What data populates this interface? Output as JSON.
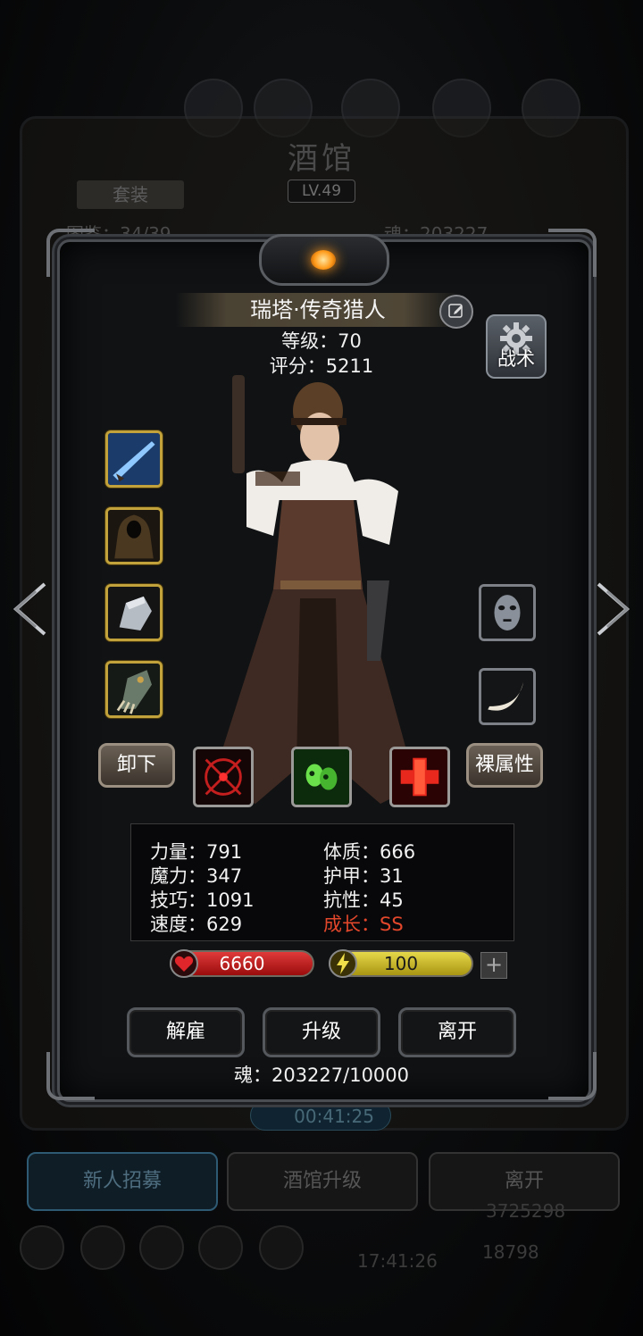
{
  "background": {
    "title": "酒馆",
    "level": "LV.49",
    "tab": "套装",
    "member_count": "图鉴：34/39",
    "soul_total": "魂：203227",
    "timer": "00:41:25",
    "clock": "17:41:26",
    "gold": "3725298",
    "gems": "18798",
    "buttons": [
      "新人招募",
      "酒馆升级",
      "离开"
    ]
  },
  "hero": {
    "name": "瑞塔·传奇猎人",
    "level_text": "等级：70",
    "score_text": "评分：5211",
    "tactics_label": "战术"
  },
  "equipment": {
    "left": [
      "rifle-weapon",
      "hooded-cloak",
      "steel-gauntlet",
      "clawed-gauntlet"
    ],
    "right": [
      "tribal-mask",
      "curved-horn"
    ]
  },
  "controls": {
    "unequip_label": "卸下",
    "base_attr_label": "裸属性"
  },
  "skills": [
    "crosshair-skill",
    "poison-skull-skill",
    "heal-cross-skill"
  ],
  "attributes": {
    "strength": "力量：791",
    "constitution": "体质：666",
    "magic": "魔力：347",
    "armor": "护甲：31",
    "skill": "技巧：1091",
    "resistance": "抗性：45",
    "speed": "速度：629",
    "growth": "成长：SS"
  },
  "resources": {
    "hp": "6660",
    "energy": "100",
    "plus": "+"
  },
  "actions": {
    "dismiss": "解雇",
    "upgrade": "升级",
    "leave": "离开"
  },
  "soul_footer": "魂：203227/10000",
  "colors": {
    "growth": "#e2472b",
    "hp_bar": "#c41e1e",
    "energy_bar": "#d4c22a",
    "slot_gold": "#c2a23a"
  }
}
